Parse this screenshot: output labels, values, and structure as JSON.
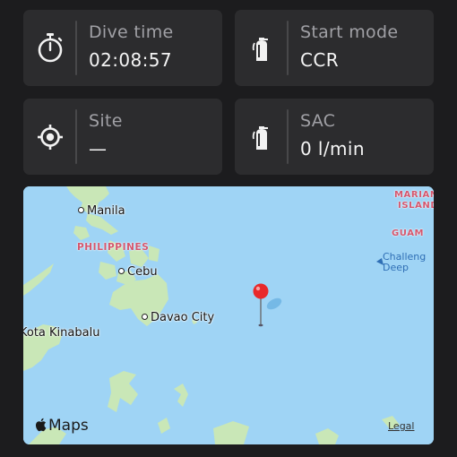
{
  "cards": {
    "dive_time": {
      "label": "Dive time",
      "value": "02:08:57",
      "icon": "stopwatch-icon"
    },
    "start_mode": {
      "label": "Start mode",
      "value": "CCR",
      "icon": "tank-icon"
    },
    "site": {
      "label": "Site",
      "value": "—",
      "icon": "location-target-icon"
    },
    "sac": {
      "label": "SAC",
      "value": "0 l/min",
      "icon": "tank-icon"
    }
  },
  "map": {
    "cities": [
      "Manila",
      "Cebu",
      "Davao City",
      "Kota Kinabalu"
    ],
    "countries": {
      "philippines": "PHILIPPINES",
      "marianas_1": "MARIAN",
      "marianas_2": "ISLAND",
      "guam": "GUAM"
    },
    "feature": {
      "line1": "Challeng",
      "line2": "Deep"
    },
    "brand": "Maps",
    "legal": "Legal"
  },
  "colors": {
    "background": "#1c1c1e",
    "card": "#2c2c2e",
    "water": "#9fd4f5",
    "land": "#c9e7b7",
    "pin": "#e8292b"
  }
}
